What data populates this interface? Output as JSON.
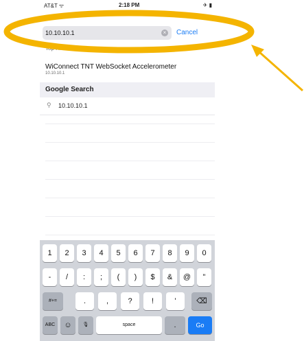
{
  "status_bar": {
    "carrier": "AT&T ᯤ",
    "time": "2:18 PM",
    "battery": "✈ ▮"
  },
  "search": {
    "value": "10.10.10.1",
    "cancel_label": "Cancel"
  },
  "suggestions": {
    "header": "Top Hit",
    "item_title": "WiConnect TNT WebSocket Accelerometer",
    "item_sub": "10.10.10.1"
  },
  "google": {
    "header": "Google Search",
    "query": "10.10.10.1"
  },
  "keyboard": {
    "row1": [
      "1",
      "2",
      "3",
      "4",
      "5",
      "6",
      "7",
      "8",
      "9",
      "0"
    ],
    "row2": [
      "-",
      "/",
      ":",
      ";",
      "(",
      ")",
      "$",
      "&",
      "@",
      "\""
    ],
    "row3_left": "#+=",
    "row3_mid": [
      ".",
      ",",
      "?",
      "!",
      "'"
    ],
    "row3_right": "⌫",
    "abc": "ABC",
    "emoji": "☺",
    "mic": "🎙",
    "space": "space",
    "dot": ".",
    "go": "Go"
  },
  "colors": {
    "accent": "#1a7cf5",
    "annotation": "#f4b400"
  }
}
